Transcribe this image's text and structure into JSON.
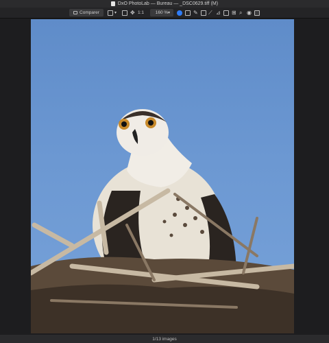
{
  "window": {
    "title": "DxO PhotoLab — Bureau — _DSC0629.tiff (M)"
  },
  "toolbar": {
    "compare_label": "Comparer",
    "ratio_label": "1:1",
    "zoom_value": "160 %",
    "icons": [
      "layout-icon",
      "chevron-down-icon",
      "folder-icon",
      "move-icon",
      "crop-icon",
      "white-balance-icon",
      "eyedropper-icon",
      "repair-icon",
      "horizon-icon",
      "perspective-icon",
      "local-adjust-icon",
      "mask-icon",
      "eye-icon",
      "exposure-icon"
    ]
  },
  "status": {
    "image_count": "1/13 images"
  },
  "photo": {
    "subject": "osprey-fledgling",
    "colors": {
      "sky": "#6c98d2",
      "accent": "#2f7cf6"
    }
  }
}
